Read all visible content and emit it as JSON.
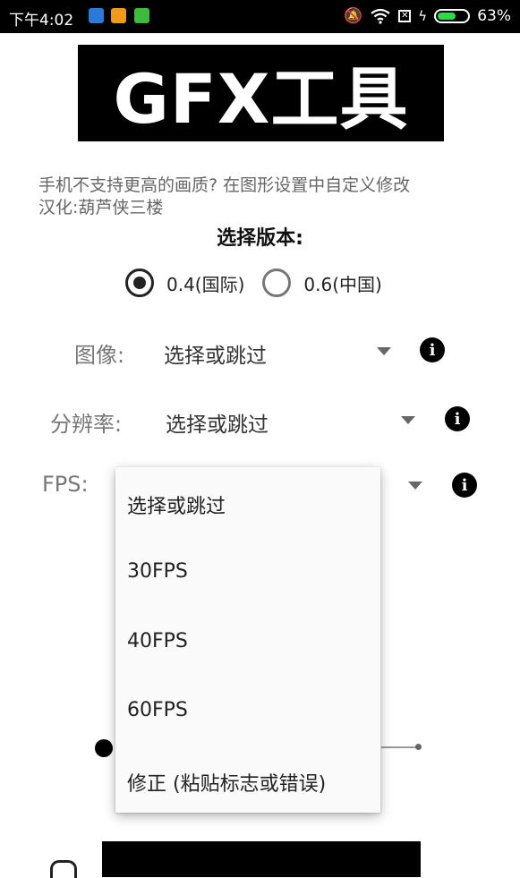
{
  "status_bar": {
    "time": "下午4:02",
    "battery": "63%",
    "battery_level": 0.63,
    "icons": [
      "shield-icon",
      "app-icon",
      "battery-saver-icon",
      "mute-icon",
      "wifi-icon",
      "sim-icon",
      "charging-icon",
      "battery-icon"
    ]
  },
  "banner": {
    "title": "GFX工具"
  },
  "description": {
    "line1": "手机不支持更高的画质? 在图形设置中自定义修改",
    "line2": "汉化:葫芦侠三楼"
  },
  "version": {
    "title": "选择版本:",
    "options": [
      {
        "label": "0.4(国际)",
        "selected": true
      },
      {
        "label": "0.6(中国)",
        "selected": false
      }
    ]
  },
  "fields": {
    "image": {
      "label": "图像:",
      "value": "选择或跳过"
    },
    "resolution": {
      "label": "分辨率:",
      "value": "选择或跳过"
    },
    "fps": {
      "label": "FPS:"
    }
  },
  "dropdown": {
    "items": [
      "选择或跳过",
      "30FPS",
      "40FPS",
      "60FPS",
      "修正 (粘贴标志或错误)"
    ]
  },
  "colors": {
    "banner_bg": "#000000",
    "battery": "#2fd84a",
    "popup_bg": "#fafafa"
  }
}
